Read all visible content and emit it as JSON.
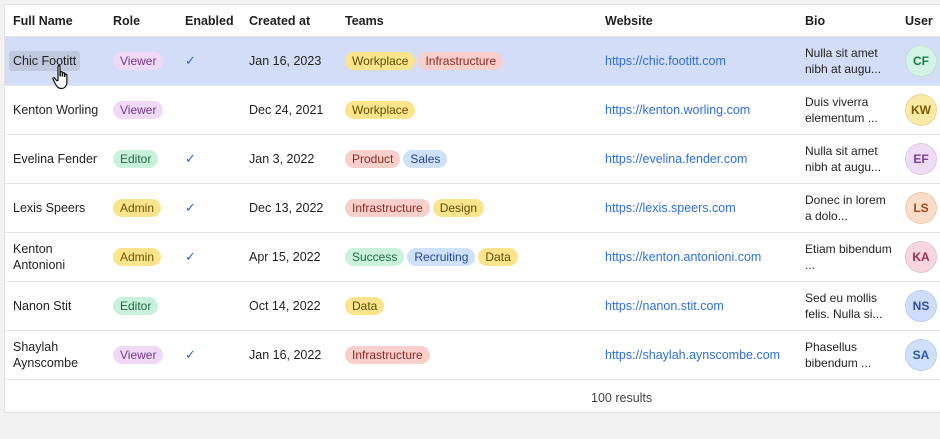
{
  "columns": [
    "Full Name",
    "Role",
    "Enabled",
    "Created at",
    "Teams",
    "Website",
    "Bio",
    "User"
  ],
  "rows": [
    {
      "name": "Chic Footitt",
      "role": "Viewer",
      "enabled": true,
      "created": "Jan 16, 2023",
      "teams": [
        "Workplace",
        "Infrastructure"
      ],
      "website": "https://chic.footitt.com",
      "bio": "Nulla sit amet nibh at augu...",
      "initials": "CF",
      "avatar_bg": "#d3f3e4",
      "avatar_fg": "#1e7a4c"
    },
    {
      "name": "Kenton Worling",
      "role": "Viewer",
      "enabled": false,
      "created": "Dec 24, 2021",
      "teams": [
        "Workplace"
      ],
      "website": "https://kenton.worling.com",
      "bio": "Duis viverra elementum ...",
      "initials": "KW",
      "avatar_bg": "#fbeaa6",
      "avatar_fg": "#7a5a00"
    },
    {
      "name": "Evelina Fender",
      "role": "Editor",
      "enabled": true,
      "created": "Jan 3, 2022",
      "teams": [
        "Product",
        "Sales"
      ],
      "website": "https://evelina.fender.com",
      "bio": "Nulla sit amet nibh at augu...",
      "initials": "EF",
      "avatar_bg": "#eedbf5",
      "avatar_fg": "#7a3f90"
    },
    {
      "name": "Lexis Speers",
      "role": "Admin",
      "enabled": true,
      "created": "Dec 13, 2022",
      "teams": [
        "Infrastructure",
        "Design"
      ],
      "website": "https://lexis.speers.com",
      "bio": "Donec in lorem a dolo...",
      "initials": "LS",
      "avatar_bg": "#fbdcc8",
      "avatar_fg": "#a04a18"
    },
    {
      "name": "Kenton Antonioni",
      "role": "Admin",
      "enabled": true,
      "created": "Apr 15, 2022",
      "teams": [
        "Success",
        "Recruiting",
        "Data"
      ],
      "website": "https://kenton.antonioni.com",
      "bio": "Etiam bibendum ...",
      "initials": "KA",
      "avatar_bg": "#f7d6df",
      "avatar_fg": "#9a2f4d"
    },
    {
      "name": "Nanon Stit",
      "role": "Editor",
      "enabled": false,
      "created": "Oct 14, 2022",
      "teams": [
        "Data"
      ],
      "website": "https://nanon.stit.com",
      "bio": "Sed eu mollis felis. Nulla si...",
      "initials": "NS",
      "avatar_bg": "#cfdcfb",
      "avatar_fg": "#2a4fa8"
    },
    {
      "name": "Shaylah Aynscombe",
      "role": "Viewer",
      "enabled": true,
      "created": "Jan 16, 2022",
      "teams": [
        "Infrastructure"
      ],
      "website": "https://shaylah.aynscombe.com",
      "bio": "Phasellus bibendum ...",
      "initials": "SA",
      "avatar_bg": "#cfe0fb",
      "avatar_fg": "#2a57a8"
    }
  ],
  "role_colors": {
    "Viewer": {
      "bg": "#f0d9f7",
      "fg": "#6e3a86"
    },
    "Editor": {
      "bg": "#c9f1dc",
      "fg": "#1d6a43"
    },
    "Admin": {
      "bg": "#fbe48c",
      "fg": "#6b5200"
    }
  },
  "team_colors": {
    "Workplace": {
      "bg": "#fbe48c",
      "fg": "#5f4a00"
    },
    "Infrastructure": {
      "bg": "#f9cfcb",
      "fg": "#8a2a22"
    },
    "Product": {
      "bg": "#f9cfcb",
      "fg": "#8a2a22"
    },
    "Sales": {
      "bg": "#cfe0fb",
      "fg": "#23468f"
    },
    "Design": {
      "bg": "#fbe48c",
      "fg": "#5f4a00"
    },
    "Success": {
      "bg": "#c9f1dc",
      "fg": "#1d6a43"
    },
    "Recruiting": {
      "bg": "#cfe0fb",
      "fg": "#23468f"
    },
    "Data": {
      "bg": "#fbe48c",
      "fg": "#5f4a00"
    }
  },
  "check_icon": "check-icon",
  "selected_row": 0,
  "footer": {
    "results": "100 results"
  }
}
